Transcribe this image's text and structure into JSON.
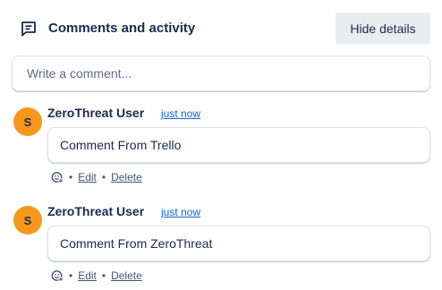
{
  "header": {
    "title": "Comments and activity",
    "icon": "comment-icon",
    "hide_details_label": "Hide details"
  },
  "composer": {
    "placeholder": "Write a comment..."
  },
  "comments": [
    {
      "avatar_initial": "S",
      "avatar_color": "#f7981d",
      "author": "ZeroThreat User",
      "timestamp": "just now",
      "body": "Comment From Trello",
      "actions": {
        "edit": "Edit",
        "delete": "Delete"
      },
      "separator": "•"
    },
    {
      "avatar_initial": "S",
      "avatar_color": "#f7981d",
      "author": "ZeroThreat User",
      "timestamp": "just now",
      "body": "Comment From ZeroThreat",
      "actions": {
        "edit": "Edit",
        "delete": "Delete"
      },
      "separator": "•"
    }
  ],
  "colors": {
    "accent_link": "#0c66e4",
    "button_bg": "#ebecf0",
    "text": "#172b4d"
  }
}
